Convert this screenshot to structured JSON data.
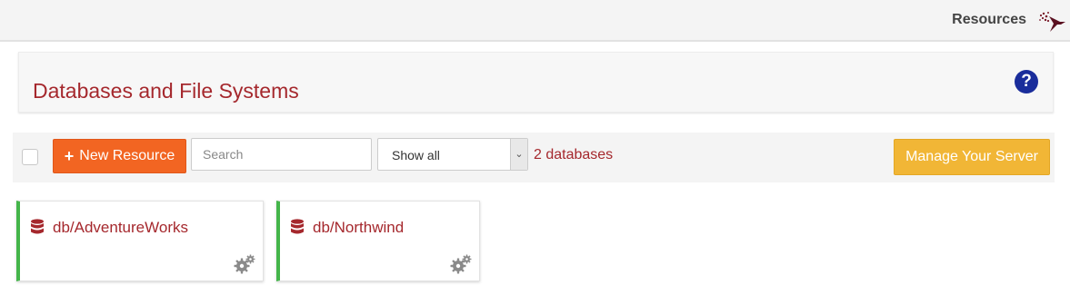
{
  "nav": {
    "resources_label": "Resources"
  },
  "header": {
    "title": "Databases and File Systems",
    "help_symbol": "?"
  },
  "toolbar": {
    "new_resource_plus": "+",
    "new_resource_label": "New Resource",
    "search_placeholder": "Search",
    "filter_value": "Show all",
    "db_count": "2 databases",
    "manage_server_label": "Manage Your Server"
  },
  "resources": [
    {
      "name": "db/AdventureWorks",
      "icon": "database-icon",
      "status_color": "#44b54a"
    },
    {
      "name": "db/Northwind",
      "icon": "database-icon",
      "status_color": "#44b54a"
    }
  ],
  "colors": {
    "accent": "#a5282d",
    "new_button": "#f26522",
    "manage_button": "#f1b636",
    "help": "#1a2d9b"
  }
}
